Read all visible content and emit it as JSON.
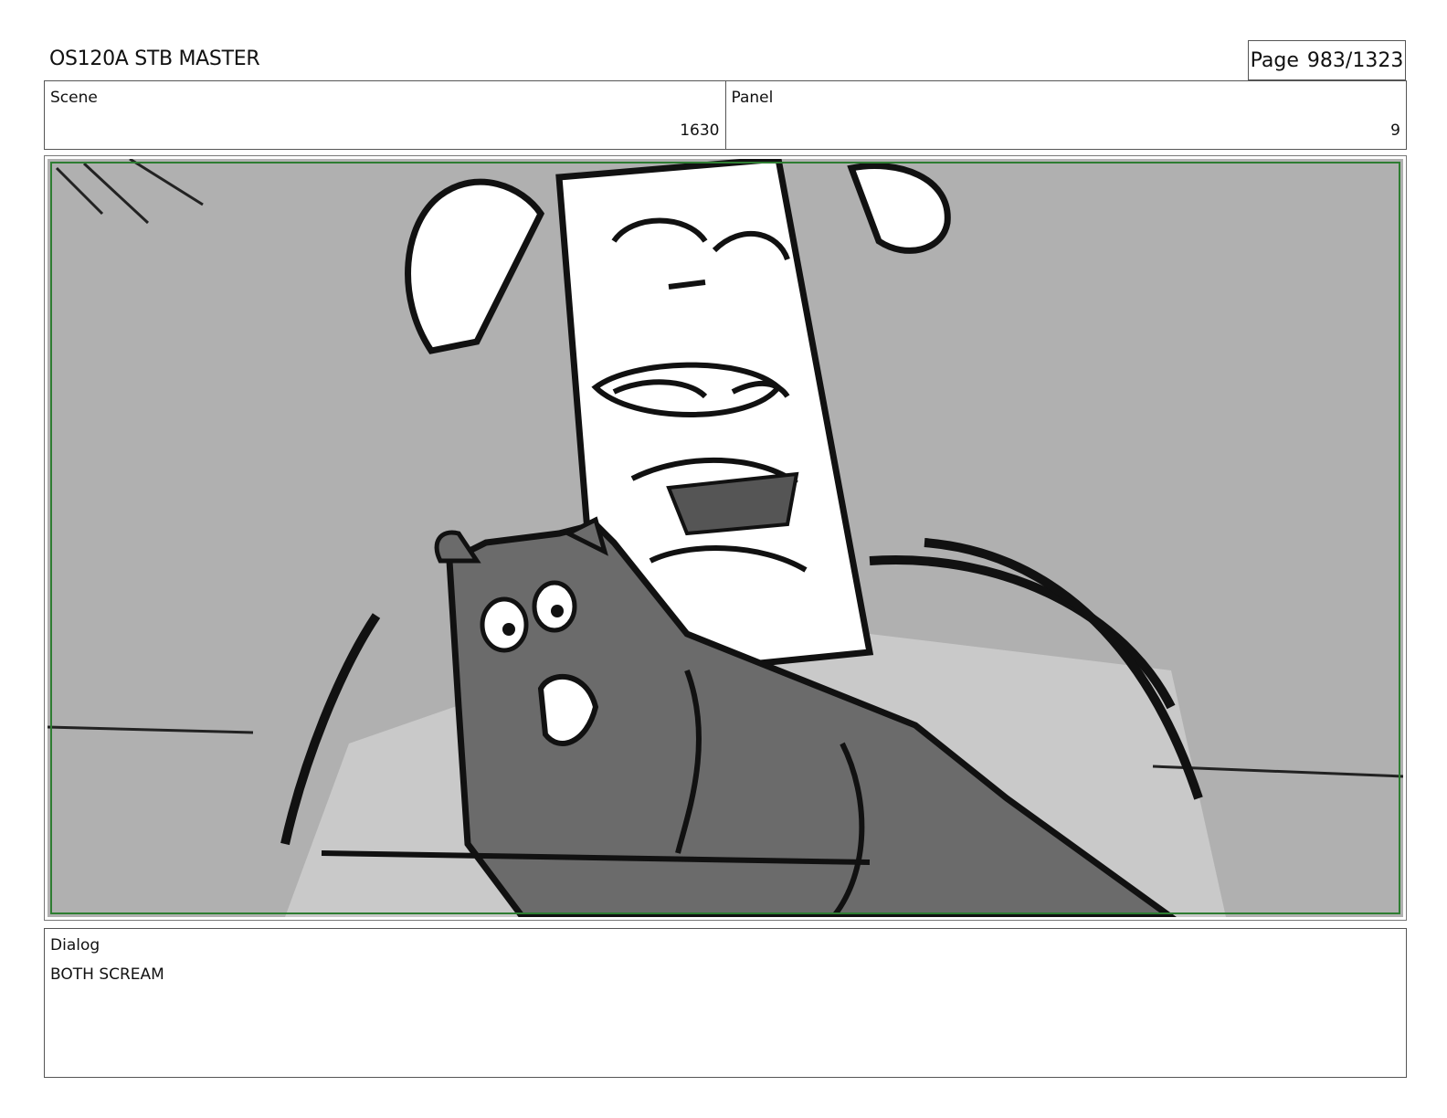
{
  "header": {
    "title": "OS120A STB MASTER",
    "page_label": "Page",
    "page_value": "983/1323"
  },
  "info": {
    "scene_label": "Scene",
    "scene_value": "1630",
    "panel_label": "Panel",
    "panel_value": "9"
  },
  "dialog": {
    "label": "Dialog",
    "text": "BOTH SCREAM"
  },
  "colors": {
    "safe_frame": "#2e7d32",
    "sky_gray": "#b0b0b0",
    "cat_gray": "#6b6b6b",
    "line_ink": "#111111"
  }
}
